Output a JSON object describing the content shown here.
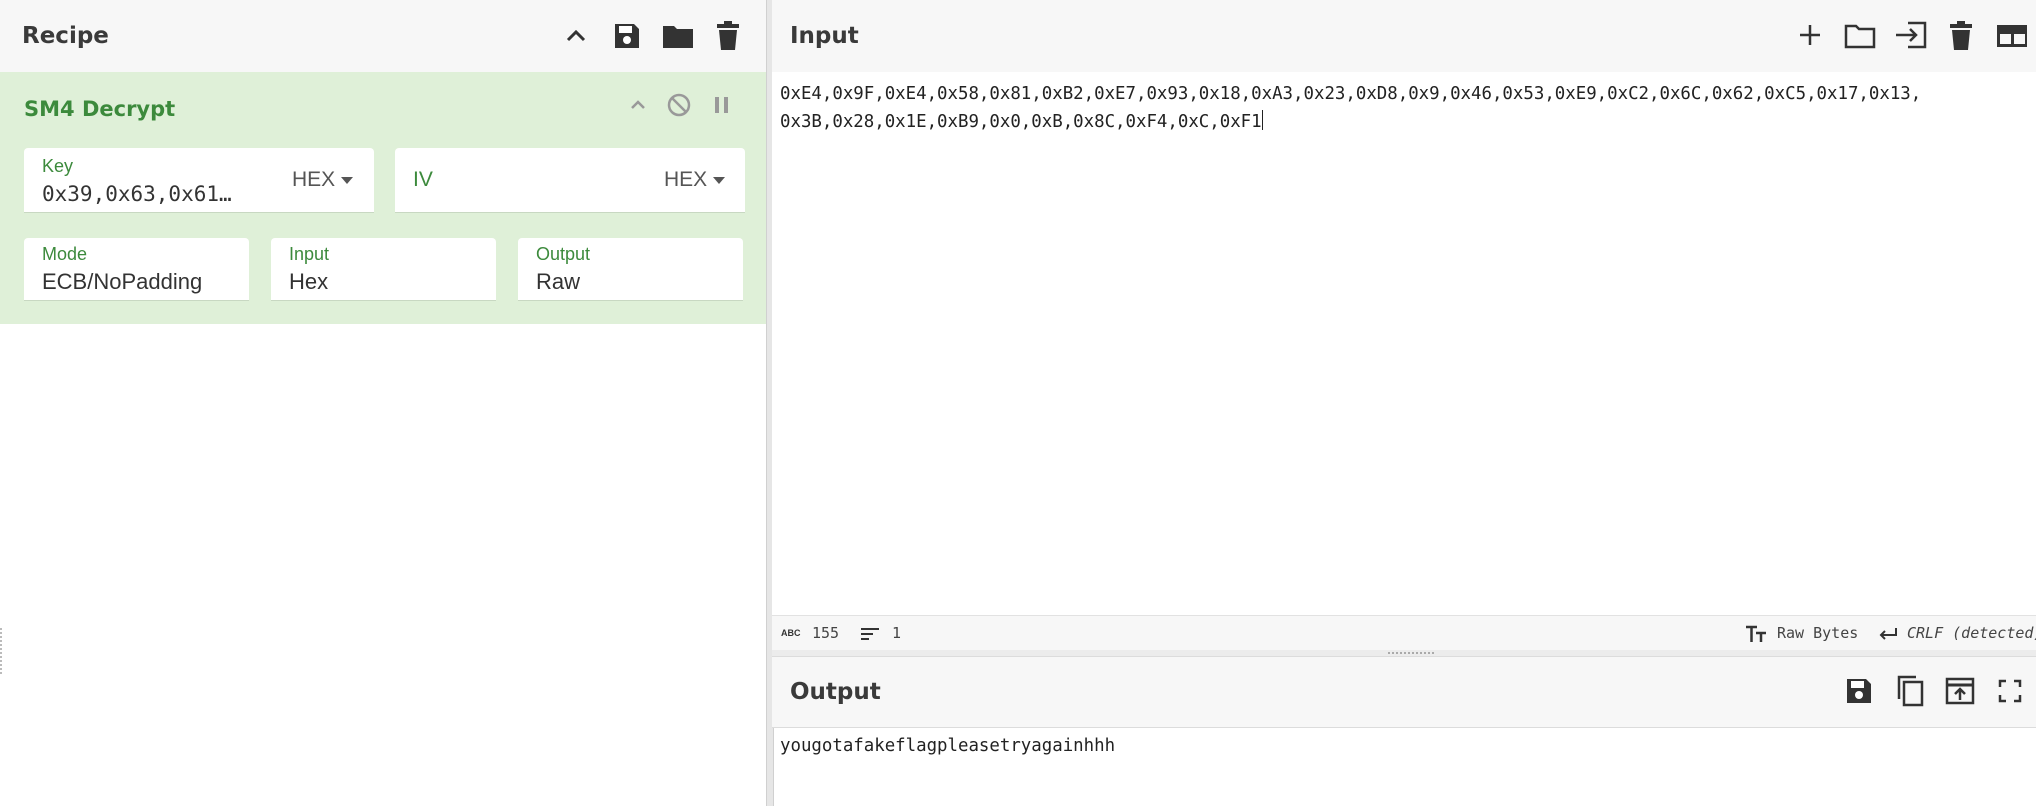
{
  "recipe": {
    "title": "Recipe",
    "operation": {
      "name": "SM4 Decrypt",
      "key": {
        "label": "Key",
        "value": "0x39,0x63,0x61…",
        "format": "HEX"
      },
      "iv": {
        "label": "IV",
        "value": "",
        "format": "HEX"
      },
      "mode": {
        "label": "Mode",
        "value": "ECB/NoPadding"
      },
      "input": {
        "label": "Input",
        "value": "Hex"
      },
      "output": {
        "label": "Output",
        "value": "Raw"
      }
    }
  },
  "input": {
    "title": "Input",
    "line1": "0xE4,0x9F,0xE4,0x58,0x81,0xB2,0xE7,0x93,0x18,0xA3,0x23,0xD8,0x9,0x46,0x53,0xE9,0xC2,0x6C,0x62,0xC5,0x17,0x13,",
    "line2": "0x3B,0x28,0x1E,0xB9,0x0,0xB,0x8C,0xF4,0xC,0xF1",
    "status": {
      "abc_icon_text": "ABC",
      "char_count": "155",
      "line_count": "1",
      "encoding": "Raw Bytes",
      "eol": "CRLF (detected)"
    }
  },
  "output": {
    "title": "Output",
    "text": "yougotafakeflagpleasetryagainhhh"
  },
  "icons": {
    "recipe": [
      "chevron-up-icon",
      "save-icon",
      "folder-icon",
      "trash-icon"
    ],
    "op": [
      "chevron-up-icon",
      "disable-icon",
      "pause-icon"
    ],
    "input": [
      "plus-icon",
      "folder-icon",
      "import-icon",
      "trash-icon",
      "layout-icon"
    ],
    "output": [
      "save-icon",
      "copy-icon",
      "replace-input-icon",
      "maximise-icon"
    ]
  },
  "colors": {
    "accent_green": "#3c8a3c",
    "op_background": "#dff0d8",
    "header_background": "#f7f7f7"
  }
}
